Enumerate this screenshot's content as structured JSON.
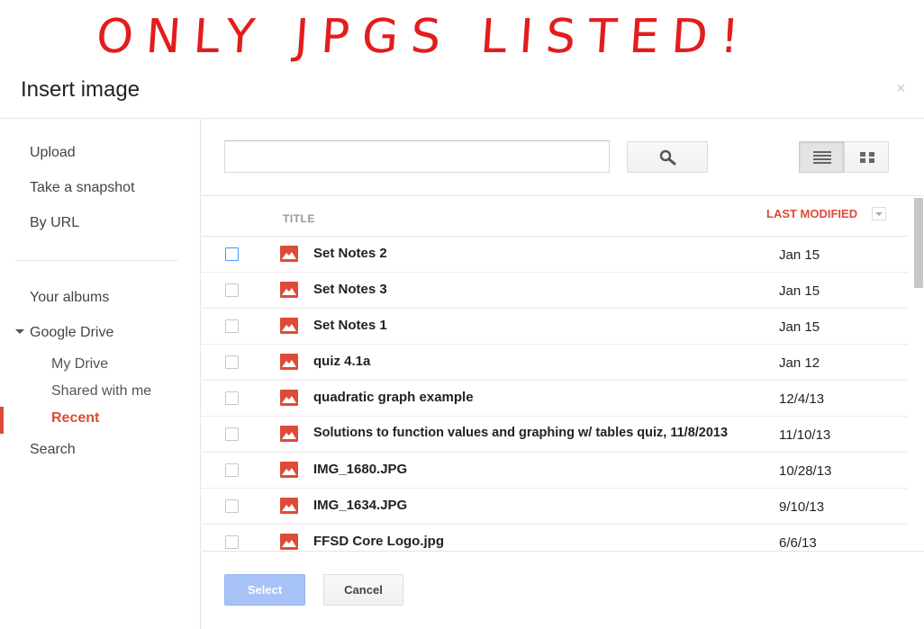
{
  "annotation": {
    "text": "ONLY JPGS LISTED!",
    "color": "#e21d1d"
  },
  "dialog": {
    "title": "Insert image",
    "close_glyph": "×"
  },
  "sidebar": {
    "upload": "Upload",
    "snapshot": "Take a snapshot",
    "by_url": "By URL",
    "albums": "Your albums",
    "drive": "Google Drive",
    "my_drive": "My Drive",
    "shared": "Shared with me",
    "recent": "Recent",
    "search": "Search"
  },
  "search": {
    "value": "",
    "placeholder": ""
  },
  "columns": {
    "title": "TITLE",
    "modified": "LAST MODIFIED"
  },
  "files": [
    {
      "name": "Set Notes 2",
      "date": "Jan 15"
    },
    {
      "name": "Set Notes 3",
      "date": "Jan 15"
    },
    {
      "name": "Set Notes 1",
      "date": "Jan 15"
    },
    {
      "name": "quiz 4.1a",
      "date": "Jan 12"
    },
    {
      "name": "quadratic graph example",
      "date": "12/4/13"
    },
    {
      "name": "Solutions to function values and graphing w/ tables quiz, 11/8/2013",
      "date": "11/10/13"
    },
    {
      "name": "IMG_1680.JPG",
      "date": "10/28/13"
    },
    {
      "name": "IMG_1634.JPG",
      "date": "9/10/13"
    },
    {
      "name": "FFSD Core Logo.jpg",
      "date": "6/6/13"
    }
  ],
  "buttons": {
    "select": "Select",
    "cancel": "Cancel"
  },
  "colors": {
    "accent": "#dd4b39",
    "select_disabled": "#a6c2f7"
  }
}
